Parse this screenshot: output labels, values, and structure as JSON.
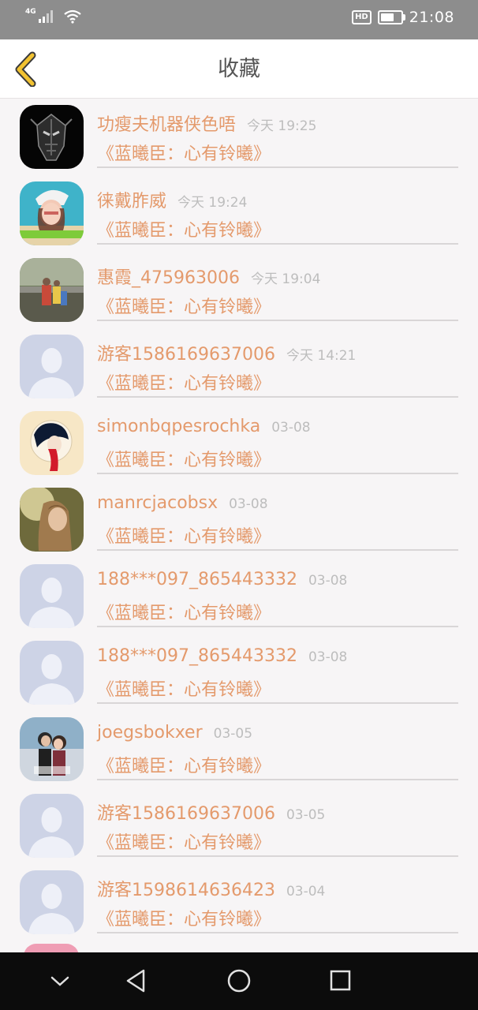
{
  "status_bar": {
    "network": "4G",
    "hd_badge": "HD",
    "time": "21:08",
    "battery_level": 0.75
  },
  "header": {
    "title": "收藏",
    "back_icon": "chevron-left-icon"
  },
  "colors": {
    "accent": "#e49a6c",
    "back_arrow": "#f1c232",
    "time_gray": "#bdbdbd",
    "background": "#f7f5f6"
  },
  "items": [
    {
      "name": "功瘦夫机器侠色唔",
      "time": "今天 19:25",
      "title": "《蓝曦臣：心有铃曦》",
      "avatar": "robot-avatar"
    },
    {
      "name": "徕戴胙威",
      "time": "今天 19:24",
      "title": "《蓝曦臣：心有铃曦》",
      "avatar": "girl-hat-avatar"
    },
    {
      "name": "惠霞_475963006",
      "time": "今天 19:04",
      "title": "《蓝曦臣：心有铃曦》",
      "avatar": "family-photo-avatar"
    },
    {
      "name": "游客1586169637006",
      "time": "今天 14:21",
      "title": "《蓝曦臣：心有铃曦》",
      "avatar": "default-avatar"
    },
    {
      "name": "simonbqpesrochka",
      "time": "03-08",
      "title": "《蓝曦臣：心有铃曦》",
      "avatar": "ink-girl-avatar"
    },
    {
      "name": "manrcjacobsx",
      "time": "03-08",
      "title": "《蓝曦臣：心有铃曦》",
      "avatar": "woman-portrait-avatar"
    },
    {
      "name": "188***097_865443332",
      "time": "03-08",
      "title": "《蓝曦臣：心有铃曦》",
      "avatar": "default-avatar"
    },
    {
      "name": "188***097_865443332",
      "time": "03-08",
      "title": "《蓝曦臣：心有铃曦》",
      "avatar": "default-avatar"
    },
    {
      "name": "joegsbokxer",
      "time": "03-05",
      "title": "《蓝曦臣：心有铃曦》",
      "avatar": "couple-avatar"
    },
    {
      "name": "游客1586169637006",
      "time": "03-05",
      "title": "《蓝曦臣：心有铃曦》",
      "avatar": "default-avatar"
    },
    {
      "name": "游客1598614636423",
      "time": "03-04",
      "title": "《蓝曦臣：心有铃曦》",
      "avatar": "default-avatar"
    }
  ],
  "nav_bar": {
    "buttons": [
      "chevron-down-icon",
      "back-triangle-icon",
      "home-circle-icon",
      "recents-square-icon"
    ]
  }
}
